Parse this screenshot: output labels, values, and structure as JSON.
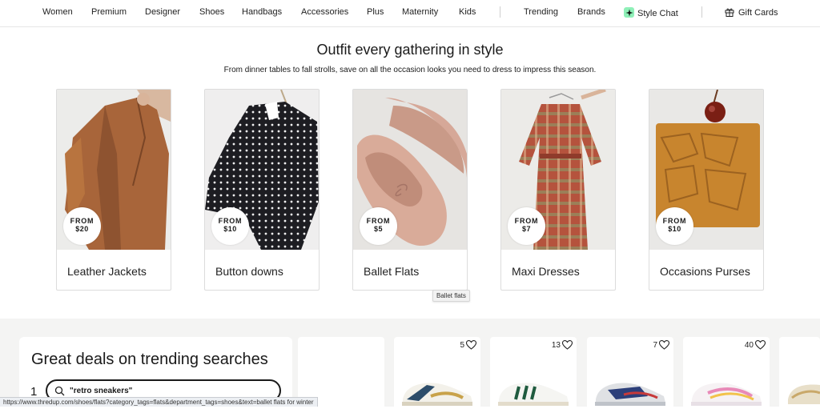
{
  "nav": {
    "items": [
      "Women",
      "Premium",
      "Designer",
      "Shoes",
      "Handbags",
      "Accessories",
      "Plus",
      "Maternity",
      "Kids"
    ],
    "trending": "Trending",
    "brands": "Brands",
    "style_chat": "Style Chat",
    "gift_cards": "Gift Cards",
    "style_chat_icon": "sparkle-icon",
    "gift_icon": "gift-icon",
    "accent": "#8ff0b8"
  },
  "hero": {
    "title": "Outfit every gathering in style",
    "subtitle": "From dinner tables to fall strolls, save on all the occasion looks you need to dress to impress this season."
  },
  "categories": [
    {
      "label": "Leather Jackets",
      "from": "FROM",
      "price": "$20"
    },
    {
      "label": "Button downs",
      "from": "FROM",
      "price": "$10"
    },
    {
      "label": "Ballet Flats",
      "from": "FROM",
      "price": "$5"
    },
    {
      "label": "Maxi Dresses",
      "from": "FROM",
      "price": "$7"
    },
    {
      "label": "Occasions Purses",
      "from": "FROM",
      "price": "$10"
    }
  ],
  "tooltip": "Ballet flats",
  "deals": {
    "title": "Great deals on trending searches",
    "rank": "1",
    "query": "\"retro sneakers\""
  },
  "products": [
    {
      "favorites": "5"
    },
    {
      "favorites": "13"
    },
    {
      "favorites": "7"
    },
    {
      "favorites": "40"
    }
  ],
  "status_url": "https://www.thredup.com/shoes/flats?category_tags=flats&department_tags=shoes&text=ballet flats for winter"
}
